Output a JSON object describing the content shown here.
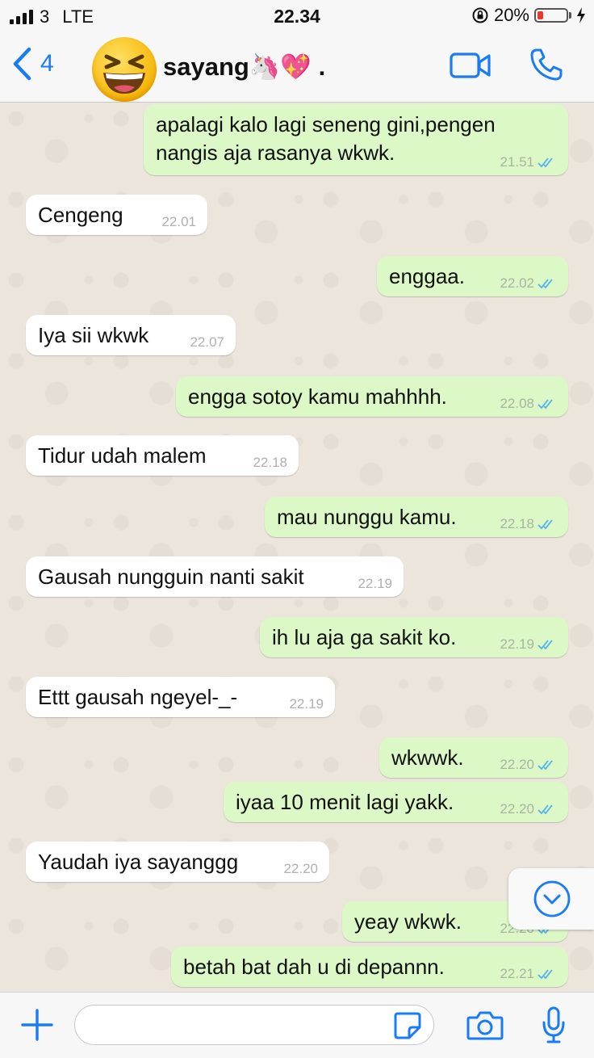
{
  "status_bar": {
    "carrier": "3",
    "network": "LTE",
    "time": "22.34",
    "battery": "20%",
    "battery_level": 0.2,
    "battery_color": "#e8392b"
  },
  "header": {
    "back_count": "4",
    "avatar_icon": "grinning-squinting-face-emoji",
    "contact_name": "sayang🦄💖 .",
    "accent_color": "#1a7cf5"
  },
  "messages": [
    {
      "dir": "out",
      "text": "apalagi kalo lagi seneng gini,pengen\nnangis aja rasanya wkwk.",
      "time": "21.51"
    },
    {
      "dir": "in",
      "text": "Cengeng",
      "time": "22.01"
    },
    {
      "dir": "out",
      "text": "enggaa.",
      "time": "22.02"
    },
    {
      "dir": "in",
      "text": "Iya sii wkwk",
      "time": "22.07"
    },
    {
      "dir": "out",
      "text": "engga sotoy kamu mahhhh.",
      "time": "22.08"
    },
    {
      "dir": "in",
      "text": "Tidur udah malem",
      "time": "22.18"
    },
    {
      "dir": "out",
      "text": "mau nunggu kamu.",
      "time": "22.18"
    },
    {
      "dir": "in",
      "text": "Gausah nungguin nanti sakit",
      "time": "22.19"
    },
    {
      "dir": "out",
      "text": "ih lu aja ga sakit ko.",
      "time": "22.19"
    },
    {
      "dir": "in",
      "text": "Ettt gausah ngeyel-_-",
      "time": "22.19"
    },
    {
      "dir": "out",
      "text": "wkwwk.",
      "time": "22.20"
    },
    {
      "dir": "out",
      "text": "iyaa 10 menit lagi yakk.",
      "time": "22.20"
    },
    {
      "dir": "in",
      "text": "Yaudah iya sayanggg",
      "time": "22.20"
    },
    {
      "dir": "out",
      "text": "yeay wkwk.",
      "time": "22.20"
    },
    {
      "dir": "out",
      "text": "betah bat dah u di depannn.",
      "time": "22.21"
    }
  ],
  "colors": {
    "outgoing_bubble": "#dcf8c6",
    "incoming_bubble": "#ffffff",
    "read_ticks": "#4fb3f0"
  },
  "input": {
    "placeholder": "",
    "value": ""
  }
}
